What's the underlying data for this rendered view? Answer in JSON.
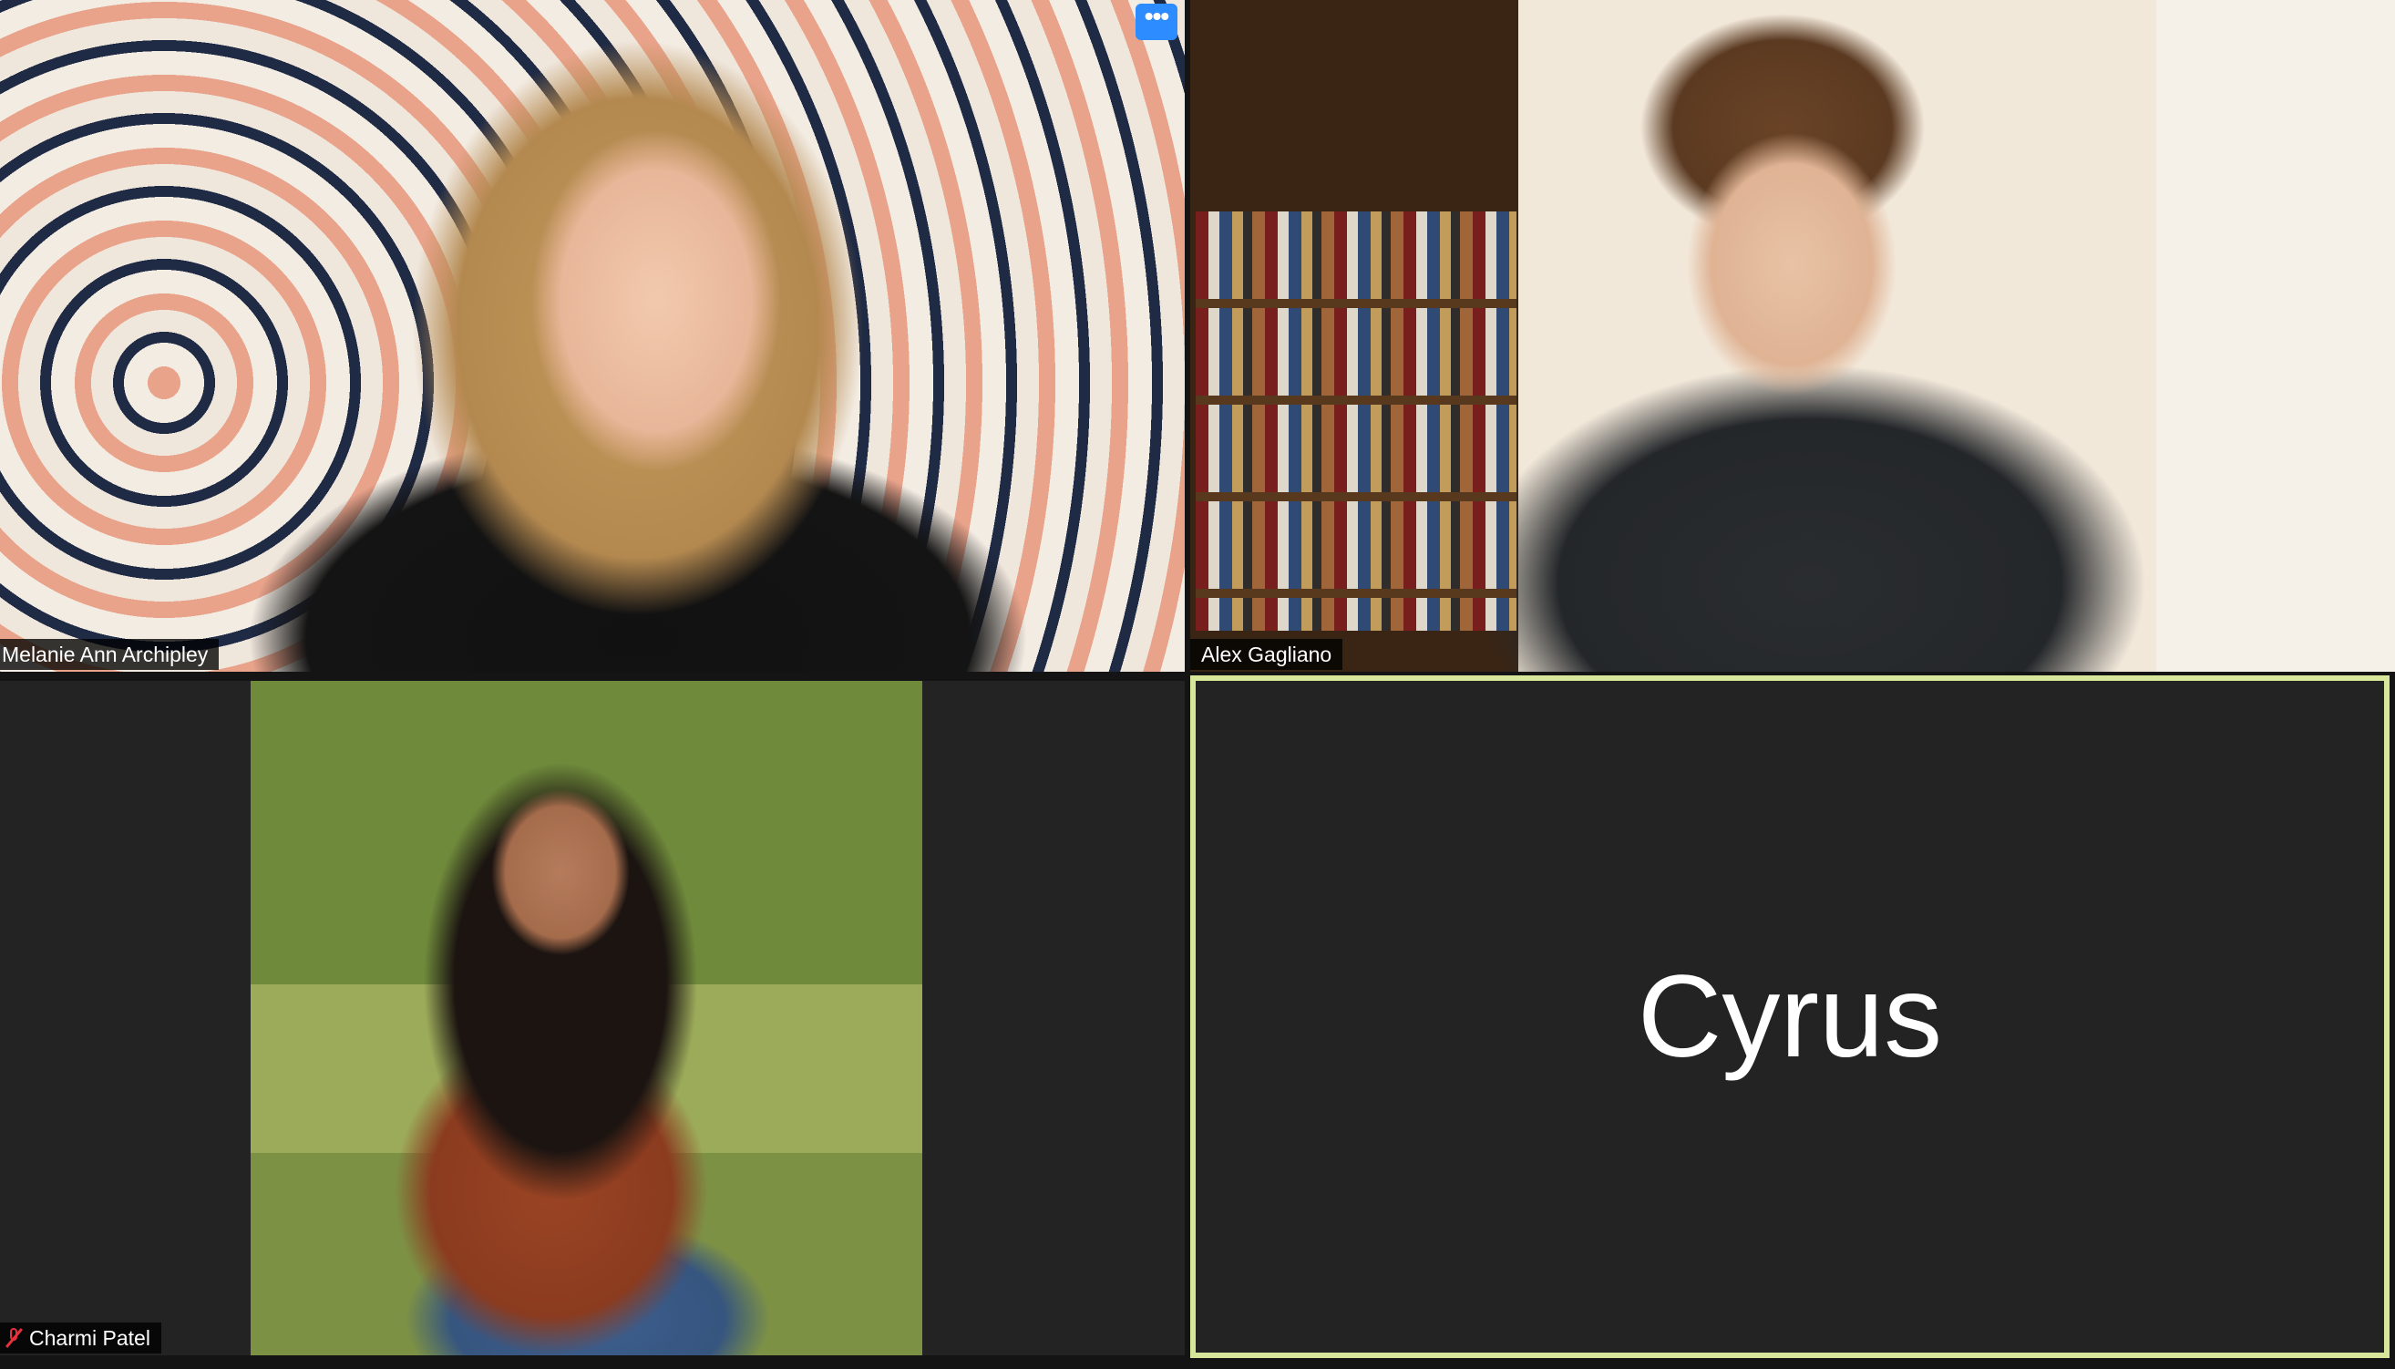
{
  "meeting": {
    "participants": [
      {
        "name": "Melanie Ann Archipley",
        "video": "on"
      },
      {
        "name": "Alex Gagliano",
        "video": "on"
      },
      {
        "name": "Charmi Patel",
        "video": "off",
        "muted": true
      },
      {
        "name": "Cyrus",
        "video": "off",
        "active_speaker": true
      }
    ],
    "more_options_glyph": "•••"
  },
  "colors": {
    "active_speaker_border": "#d7e69a",
    "more_button_bg": "#2d8cff",
    "muted_icon": "#e5323c",
    "tile_bg": "#232323"
  },
  "icons": [
    "more-options-icon",
    "mic-muted-icon"
  ]
}
